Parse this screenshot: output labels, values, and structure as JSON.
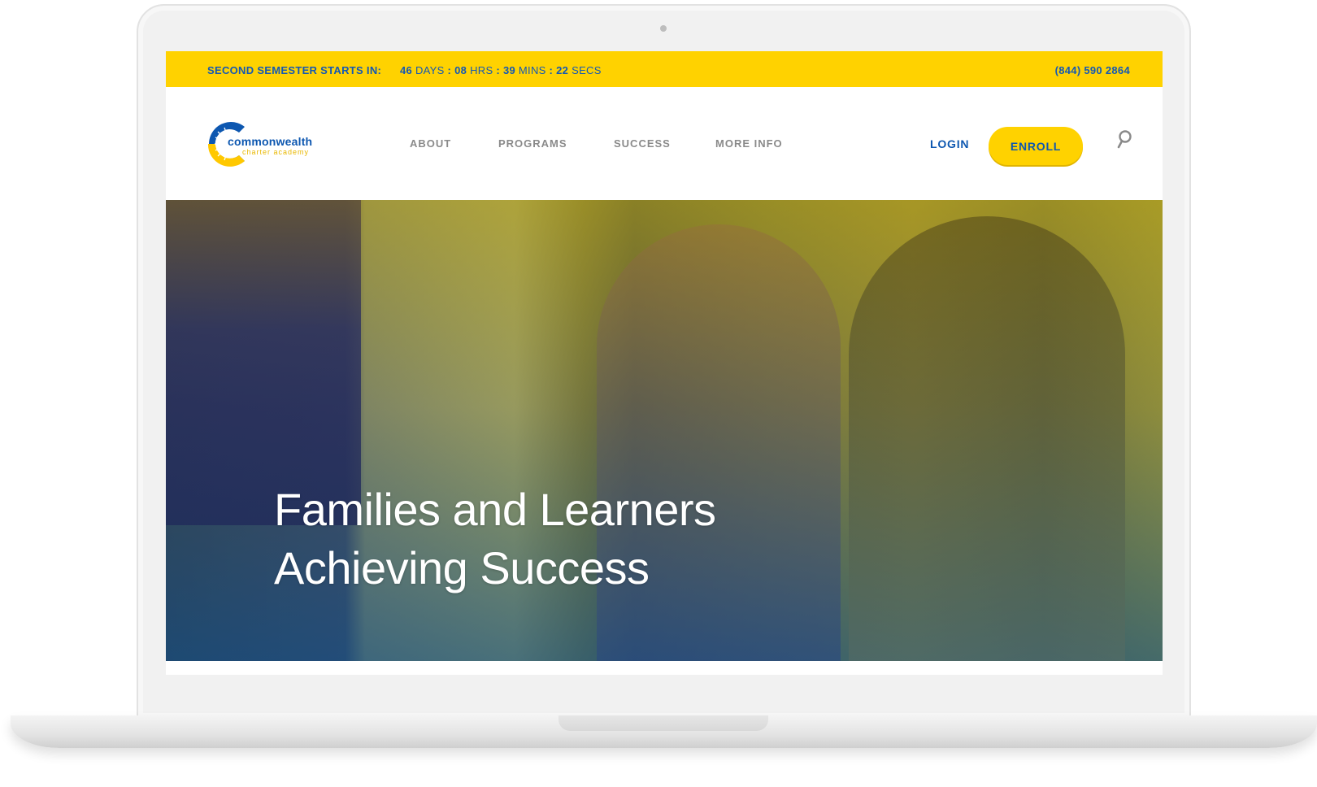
{
  "countdown": {
    "label": "SECOND SEMESTER STARTS IN:",
    "days": "46",
    "days_unit": "DAYS",
    "hours": "08",
    "hours_unit": "HRS",
    "mins": "39",
    "mins_unit": "MINS",
    "secs": "22",
    "secs_unit": "SECS",
    "sep": ":"
  },
  "phone": "(844) 590 2864",
  "logo": {
    "name": "commonwealth",
    "tagline": "charter academy"
  },
  "nav": [
    {
      "label": "ABOUT"
    },
    {
      "label": "PROGRAMS"
    },
    {
      "label": "SUCCESS"
    },
    {
      "label": "MORE INFO"
    }
  ],
  "login": "LOGIN",
  "enroll": "ENROLL",
  "search_icon": "search-icon",
  "hero": {
    "line1": "Families and Learners",
    "line2": "Achieving Success"
  },
  "colors": {
    "accent_yellow": "#ffd200",
    "brand_blue": "#0d57b0"
  }
}
